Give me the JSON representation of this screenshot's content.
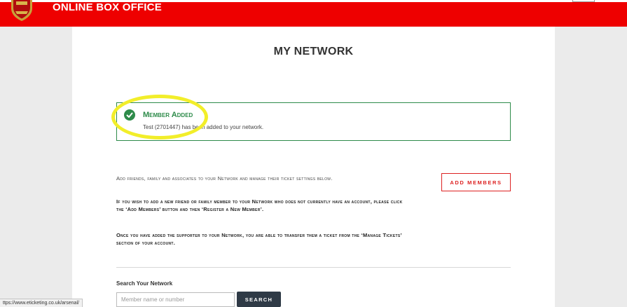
{
  "header": {
    "brand": "ONLINE BOX OFFICE",
    "crest_icon": "club-crest-icon",
    "color": "#ee0000"
  },
  "page": {
    "title": "MY NETWORK"
  },
  "alert": {
    "icon": "check-circle-icon",
    "title": "Member Added",
    "message": "Test (2701447) has been added to your network.",
    "color": "#2e8b4a"
  },
  "intro": {
    "text": "Add friends, family and associates to your Network and manage their ticket settings below."
  },
  "instructions": [
    "If you wish to add a new friend or family member to your Network who does not currently have an account, please click the ‘Add Members’ button and then ‘Register a New Member’.",
    "Once you have added the supporter to your Network, you are able to transfer them a ticket from the ‘Manage Tickets’ section of your account."
  ],
  "actions": {
    "add_members_label": "Add members"
  },
  "search": {
    "label": "Search Your Network",
    "placeholder": "Member name or number",
    "button_label": "Search"
  },
  "status_bar": {
    "url": "ttps://www.eticketing.co.uk/arsenal/"
  }
}
